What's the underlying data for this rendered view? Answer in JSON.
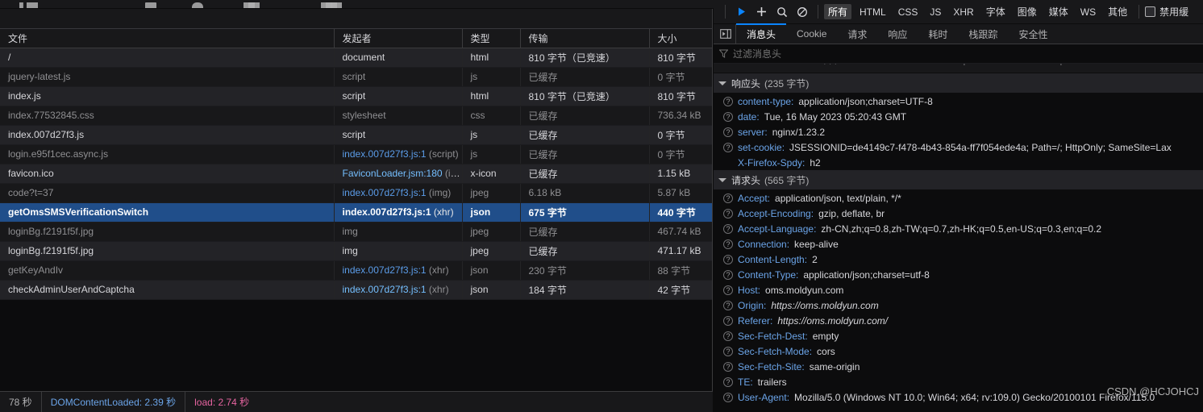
{
  "network_list": {
    "columns": [
      "文件",
      "发起者",
      "类型",
      "传输",
      "大小"
    ],
    "rows": [
      {
        "file": "/",
        "initiator": "document",
        "initiator_link": false,
        "type": "html",
        "transferred": "810 字节（已竞速）",
        "size": "810 字节"
      },
      {
        "file": "jquery-latest.js",
        "initiator": "script",
        "initiator_link": false,
        "type": "js",
        "transferred": "已缓存",
        "size": "0 字节"
      },
      {
        "file": "index.js",
        "initiator": "script",
        "initiator_link": false,
        "type": "html",
        "transferred": "810 字节（已竞速）",
        "size": "810 字节"
      },
      {
        "file": "index.77532845.css",
        "initiator": "stylesheet",
        "initiator_link": false,
        "type": "css",
        "transferred": "已缓存",
        "size": "736.34 kB"
      },
      {
        "file": "index.007d27f3.js",
        "initiator": "script",
        "initiator_link": false,
        "type": "js",
        "transferred": "已缓存",
        "size": "0 字节"
      },
      {
        "file": "login.e95f1cec.async.js",
        "initiator": "index.007d27f3.js:1",
        "initiator_suffix": " (script)",
        "initiator_link": true,
        "type": "js",
        "transferred": "已缓存",
        "size": "0 字节"
      },
      {
        "file": "favicon.ico",
        "initiator": "FaviconLoader.jsm:180",
        "initiator_suffix": " (img)",
        "initiator_link": true,
        "type": "x-icon",
        "transferred": "已缓存",
        "size": "1.15 kB"
      },
      {
        "file": "code?t=37",
        "initiator": "index.007d27f3.js:1",
        "initiator_suffix": " (img)",
        "initiator_link": true,
        "type": "jpeg",
        "transferred": "6.18 kB",
        "size": "5.87 kB"
      },
      {
        "file": "getOmsSMSVerificationSwitch",
        "initiator": "index.007d27f3.js:1",
        "initiator_suffix": " (xhr)",
        "initiator_link": true,
        "type": "json",
        "transferred": "675 字节",
        "size": "440 字节",
        "selected": true
      },
      {
        "file": "loginBg.f2191f5f.jpg",
        "initiator": "img",
        "initiator_link": false,
        "type": "jpeg",
        "transferred": "已缓存",
        "size": "467.74 kB"
      },
      {
        "file": "loginBg.f2191f5f.jpg",
        "initiator": "img",
        "initiator_link": false,
        "type": "jpeg",
        "transferred": "已缓存",
        "size": "471.17 kB"
      },
      {
        "file": "getKeyAndIv",
        "initiator": "index.007d27f3.js:1",
        "initiator_suffix": " (xhr)",
        "initiator_link": true,
        "type": "json",
        "transferred": "230 字节",
        "size": "88 字节"
      },
      {
        "file": "checkAdminUserAndCaptcha",
        "initiator": "index.007d27f3.js:1",
        "initiator_suffix": " (xhr)",
        "initiator_link": true,
        "type": "json",
        "transferred": "184 字节",
        "size": "42 字节"
      }
    ]
  },
  "statusbar": {
    "total_time": "78 秒",
    "dom_content_loaded": "DOMContentLoaded: 2.39 秒",
    "load": "load: 2.74 秒"
  },
  "toolbar": {
    "play_icon": "play-icon",
    "add_icon": "plus-icon",
    "search_icon": "search-icon",
    "block_icon": "block-icon",
    "filters": [
      {
        "label": "所有",
        "active": true
      },
      {
        "label": "HTML",
        "active": false
      },
      {
        "label": "CSS",
        "active": false
      },
      {
        "label": "JS",
        "active": false
      },
      {
        "label": "XHR",
        "active": false
      },
      {
        "label": "字体",
        "active": false
      },
      {
        "label": "图像",
        "active": false
      },
      {
        "label": "媒体",
        "active": false
      },
      {
        "label": "WS",
        "active": false
      },
      {
        "label": "其他",
        "active": false
      }
    ],
    "disable_cache_label": "禁用缓"
  },
  "detail": {
    "tabs": [
      {
        "label": "消息头",
        "active": true
      },
      {
        "label": "Cookie",
        "active": false
      },
      {
        "label": "请求",
        "active": false
      },
      {
        "label": "响应",
        "active": false
      },
      {
        "label": "耗时",
        "active": false
      },
      {
        "label": "栈跟踪",
        "active": false
      },
      {
        "label": "安全性",
        "active": false
      }
    ],
    "filter_placeholder": "过滤消息头",
    "response_group": {
      "title": "响应头",
      "count": "(235 字节)"
    },
    "response_headers": [
      {
        "name": "content-type:",
        "value": "application/json;charset=UTF-8",
        "bullet": true
      },
      {
        "name": "date:",
        "value": "Tue, 16 May 2023 05:20:43 GMT",
        "bullet": true
      },
      {
        "name": "server:",
        "value": "nginx/1.23.2",
        "bullet": true
      },
      {
        "name": "set-cookie:",
        "value": "JSESSIONID=de4149c7-f478-4b43-854a-ff7f054ede4a; Path=/; HttpOnly; SameSite=Lax",
        "bullet": true
      },
      {
        "name": "X-Firefox-Spdy:",
        "value": "h2",
        "bullet": false
      }
    ],
    "request_group": {
      "title": "请求头",
      "count": "(565 字节)"
    },
    "request_headers": [
      {
        "name": "Accept:",
        "value": "application/json, text/plain, */*",
        "bullet": true
      },
      {
        "name": "Accept-Encoding:",
        "value": "gzip, deflate, br",
        "bullet": true
      },
      {
        "name": "Accept-Language:",
        "value": "zh-CN,zh;q=0.8,zh-TW;q=0.7,zh-HK;q=0.5,en-US;q=0.3,en;q=0.2",
        "bullet": true
      },
      {
        "name": "Connection:",
        "value": "keep-alive",
        "bullet": true
      },
      {
        "name": "Content-Length:",
        "value": "2",
        "bullet": true
      },
      {
        "name": "Content-Type:",
        "value": "application/json;charset=utf-8",
        "bullet": true
      },
      {
        "name": "Host:",
        "value": "oms.moldyun.com",
        "bullet": true
      },
      {
        "name": "Origin:",
        "value": "https://oms.moldyun.com",
        "bullet": true,
        "italic": true
      },
      {
        "name": "Referer:",
        "value": "https://oms.moldyun.com/",
        "bullet": true,
        "italic": true
      },
      {
        "name": "Sec-Fetch-Dest:",
        "value": "empty",
        "bullet": true
      },
      {
        "name": "Sec-Fetch-Mode:",
        "value": "cors",
        "bullet": true
      },
      {
        "name": "Sec-Fetch-Site:",
        "value": "same-origin",
        "bullet": true
      },
      {
        "name": "TE:",
        "value": "trailers",
        "bullet": true
      },
      {
        "name": "User-Agent:",
        "value": "Mozilla/5.0 (Windows NT 10.0; Win64; x64; rv:109.0) Gecko/20100101 Firefox/115.0",
        "bullet": true
      }
    ]
  },
  "watermark": "CSDN @HCJOHCJ",
  "colors": {
    "selection": "#204e8a",
    "accent": "#0a84ff",
    "link": "#6ba4e8",
    "dcl": "#6ba4e8",
    "load": "#e664a0"
  }
}
